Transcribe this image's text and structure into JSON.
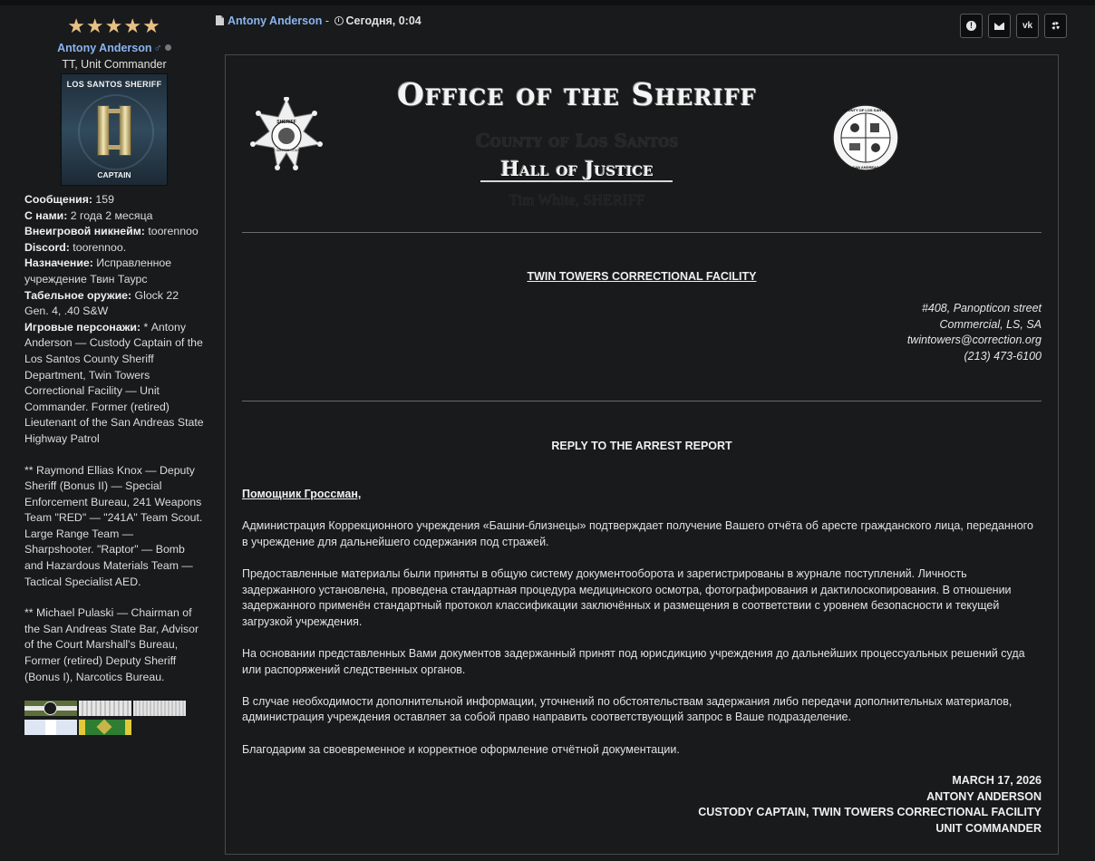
{
  "sidebar": {
    "stars": "★★★★★",
    "username": "Antony Anderson",
    "gender_symbol": "♂",
    "user_title": "TT, Unit Commander",
    "avatar": {
      "top_text": "LOS SANTOS SHERIFF",
      "bottom_text": "CAPTAIN"
    },
    "stats": [
      {
        "label": "Сообщения:",
        "value": " 159"
      },
      {
        "label": "С нами:",
        "value": " 2 года 2 месяца"
      },
      {
        "label": "Внеигровой никнейм:",
        "value": " toorennoo"
      },
      {
        "label": "Discord:",
        "value": " toorennoo."
      },
      {
        "label": "Назначение:",
        "value": " Исправленное учреждение Твин Таурс"
      },
      {
        "label": "Табельное оружие:",
        "value": " Glock 22 Gen. 4, .40 S&W"
      },
      {
        "label": "Игровые персонажи:",
        "value": " * Antony Anderson — Custody Captain of the Los Santos County Sheriff Department, Twin Towers Correctional Facility — Unit Commander. Former (retired) Lieutenant of the San Andreas State Highway Patrol"
      }
    ],
    "characters_extra": [
      "** Raymond Ellias Knox — Deputy Sheriff (Bonus II) — Special Enforcement Bureau, 241 Weapons Team \"RED\" — \"241A\" Team Scout. Large Range Team — Sharpshooter. \"Raptor\" — Bomb and Hazardous Materials Team — Tactical Specialist AED.",
      "** Michael Pulaski — Chairman of the San Andreas State Bar, Advisor of the Court Marshall's Bureau, Former (retired) Deputy Sheriff (Bonus I), Narcotics Bureau."
    ]
  },
  "post": {
    "author": "Antony Anderson",
    "separator": " - ",
    "date": "Сегодня, 0:04",
    "actions": [
      "report-icon",
      "envelope-icon",
      "vk-icon",
      "gear-icon"
    ]
  },
  "letterhead": {
    "title": "Office of the Sheriff",
    "county": "County of Los Santos",
    "hall": "Hall of Justice",
    "sheriff": "Tim White, SHERIFF",
    "badge_text_top": "SHERIFF",
    "badge_text_bottom": "LOS SANTOS COUNTY",
    "seal_text_top": "COUNTY OF LOS SANTOS",
    "seal_text_bottom": "SAN ANDREAS"
  },
  "facility": "TWIN TOWERS CORRECTIONAL FACILITY",
  "address": [
    "#408, Panopticon street",
    "Commercial, LS, SA",
    "twintowers@correction.org",
    "(213) 473-6100"
  ],
  "reply_title": "REPLY TO THE ARREST REPORT",
  "greeting": "Помощник Гроссман,",
  "paragraphs": [
    "Администрация Коррекционного учреждения «Башни-близнецы» подтверждает получение Вашего отчёта об аресте гражданского лица, переданного в учреждение для дальнейшего содержания под стражей.",
    "Предоставленные материалы были приняты в общую систему документооборота и зарегистрированы в журнале поступлений. Личность задержанного установлена, проведена стандартная процедура медицинского осмотра, фотографирования и дактилоскопирования. В отношении задержанного применён стандартный протокол классификации заключённых и размещения в соответствии с уровнем безопасности и текущей загрузкой учреждения.",
    "На основании представленных Вами документов задержанный принят под юрисдикцию учреждения до дальнейших процессуальных решений суда или распоряжений следственных органов.",
    "В случае необходимости дополнительной информации, уточнений по обстоятельствам задержания либо передачи дополнительных материалов, администрация учреждения оставляет за собой право направить соответствующий запрос в Ваше подразделение.",
    "Благодарим за своевременное и корректное оформление отчётной документации."
  ],
  "signature": [
    "MARCH 17, 2026",
    "ANTONY ANDERSON",
    "CUSTODY CAPTAIN, TWIN TOWERS CORRECTIONAL FACILITY",
    "UNIT COMMANDER"
  ]
}
